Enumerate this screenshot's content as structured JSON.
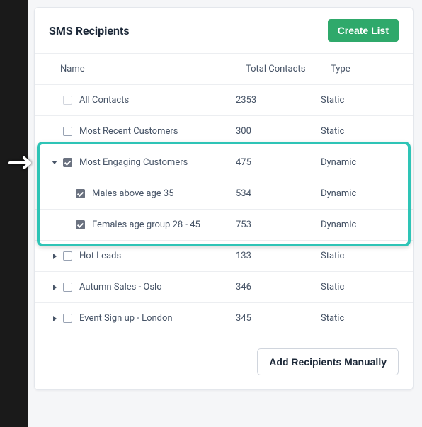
{
  "header": {
    "title": "SMS Recipients",
    "create_btn": "Create List"
  },
  "columns": {
    "name": "Name",
    "contacts": "Total Contacts",
    "type": "Type"
  },
  "rows": [
    {
      "expand": null,
      "checked": false,
      "faded": true,
      "indent": false,
      "name": "All Contacts",
      "contacts": "2353",
      "type": "Static"
    },
    {
      "expand": null,
      "checked": false,
      "faded": false,
      "indent": false,
      "name": "Most Recent Customers",
      "contacts": "300",
      "type": "Static"
    },
    {
      "expand": "down",
      "checked": true,
      "faded": false,
      "indent": false,
      "name": "Most Engaging Customers",
      "contacts": "475",
      "type": "Dynamic"
    },
    {
      "expand": null,
      "checked": true,
      "faded": false,
      "indent": true,
      "name": "Males above age 35",
      "contacts": "534",
      "type": "Dynamic"
    },
    {
      "expand": null,
      "checked": true,
      "faded": false,
      "indent": true,
      "name": "Females age group 28 - 45",
      "contacts": "753",
      "type": "Dynamic"
    },
    {
      "expand": "right",
      "checked": false,
      "faded": false,
      "indent": false,
      "name": "Hot Leads",
      "contacts": "133",
      "type": "Static"
    },
    {
      "expand": "right",
      "checked": false,
      "faded": false,
      "indent": false,
      "name": "Autumn Sales - Oslo",
      "contacts": "346",
      "type": "Static"
    },
    {
      "expand": "right",
      "checked": false,
      "faded": false,
      "indent": false,
      "name": "Event Sign up - London",
      "contacts": "345",
      "type": "Static"
    }
  ],
  "footer": {
    "manual_btn": "Add Recipients Manually"
  },
  "annotation": {
    "highlight_row_start": 2,
    "highlight_row_count": 3,
    "arrow_row": 2
  },
  "colors": {
    "accent_green": "#2fa96b",
    "highlight_teal": "#2ec4b6"
  }
}
